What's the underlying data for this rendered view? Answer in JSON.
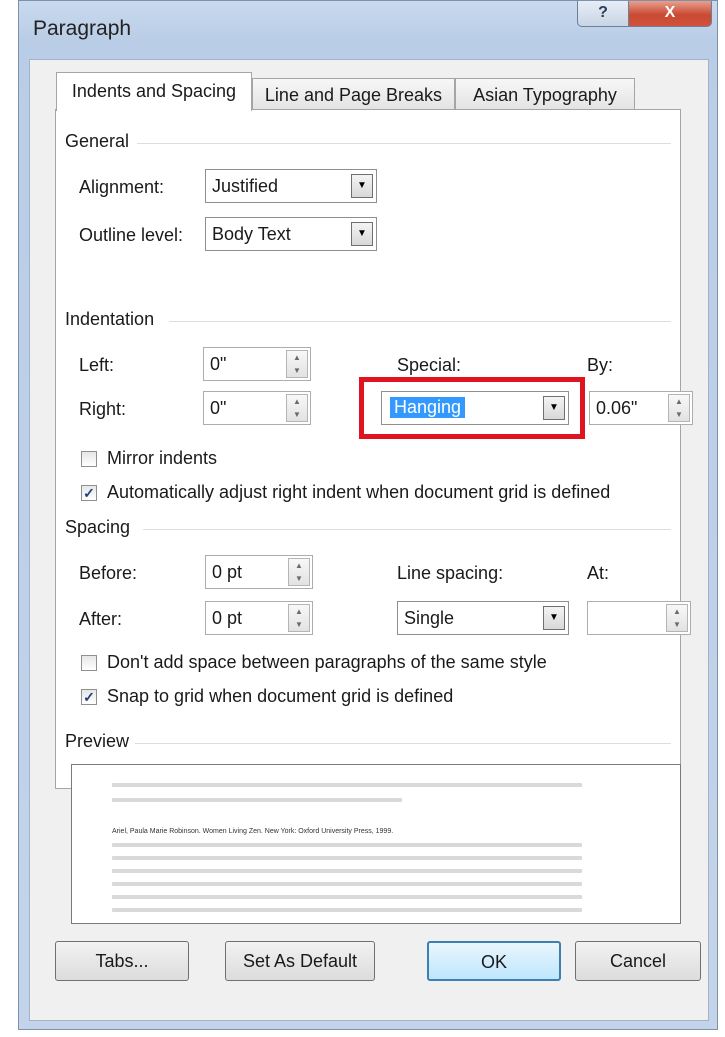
{
  "window": {
    "title": "Paragraph",
    "help_label": "?",
    "close_label": "X"
  },
  "tabs": [
    "Indents and Spacing",
    "Line and Page Breaks",
    "Asian Typography"
  ],
  "general": {
    "heading": "General",
    "alignment_label": "Alignment:",
    "alignment_value": "Justified",
    "outline_label": "Outline level:",
    "outline_value": "Body Text"
  },
  "indentation": {
    "heading": "Indentation",
    "left_label": "Left:",
    "left_value": "0\"",
    "right_label": "Right:",
    "right_value": "0\"",
    "special_label": "Special:",
    "special_value": "Hanging",
    "by_label": "By:",
    "by_value": "0.06\"",
    "mirror_label": "Mirror indents",
    "mirror_checked": false,
    "auto_adjust_label": "Automatically adjust right indent when document grid is defined",
    "auto_adjust_checked": true
  },
  "spacing": {
    "heading": "Spacing",
    "before_label": "Before:",
    "before_value": "0 pt",
    "after_label": "After:",
    "after_value": "0 pt",
    "line_spacing_label": "Line spacing:",
    "line_spacing_value": "Single",
    "at_label": "At:",
    "at_value": "",
    "no_space_label": "Don't add space between paragraphs of the same style",
    "no_space_checked": false,
    "snap_label": "Snap to grid when document grid is defined",
    "snap_checked": true
  },
  "preview": {
    "heading": "Preview",
    "sample_text": "Ariel, Paula Marie Robinson. Women Living Zen. New York: Oxford University Press, 1999."
  },
  "buttons": {
    "tabs": "Tabs...",
    "set_default": "Set As Default",
    "ok": "OK",
    "cancel": "Cancel"
  },
  "colors": {
    "highlight": "#e0141e",
    "selection": "#3399ff"
  }
}
